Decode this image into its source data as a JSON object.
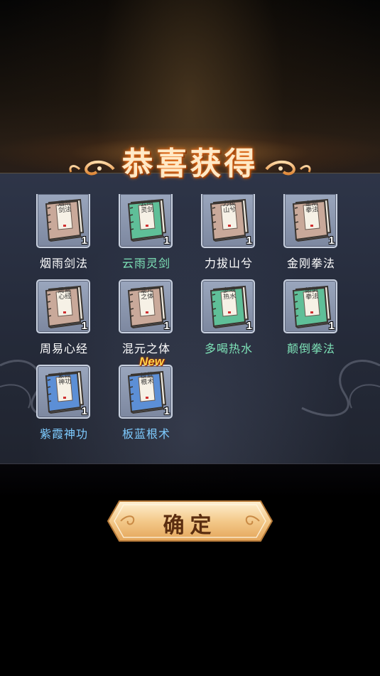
{
  "dialog": {
    "title": "恭喜获得",
    "confirm_label": "确定"
  },
  "rewards": [
    {
      "name": "烟雨剑法",
      "cover_text": "烟雨剑法",
      "quantity": "1",
      "cover_color": "#c9a99a",
      "name_color": "#ffffff",
      "is_new": false,
      "new_label": ""
    },
    {
      "name": "云雨灵剑",
      "cover_text": "云雨灵剑",
      "quantity": "1",
      "cover_color": "#5fbf98",
      "name_color": "#7ee3b8",
      "is_new": false,
      "new_label": ""
    },
    {
      "name": "力拔山兮",
      "cover_text": "力拔山兮",
      "quantity": "1",
      "cover_color": "#c9a99a",
      "name_color": "#ffffff",
      "is_new": false,
      "new_label": ""
    },
    {
      "name": "金刚拳法",
      "cover_text": "金刚拳法",
      "quantity": "1",
      "cover_color": "#c9a99a",
      "name_color": "#ffffff",
      "is_new": false,
      "new_label": ""
    },
    {
      "name": "周易心经",
      "cover_text": "周易心经",
      "quantity": "1",
      "cover_color": "#c9a99a",
      "name_color": "#ffffff",
      "is_new": false,
      "new_label": ""
    },
    {
      "name": "混元之体",
      "cover_text": "混元之体",
      "quantity": "1",
      "cover_color": "#c9a99a",
      "name_color": "#ffffff",
      "is_new": false,
      "new_label": ""
    },
    {
      "name": "多喝热水",
      "cover_text": "多喝热水",
      "quantity": "1",
      "cover_color": "#5fbf98",
      "name_color": "#7ee3b8",
      "is_new": false,
      "new_label": ""
    },
    {
      "name": "颠倒拳法",
      "cover_text": "颠倒拳法",
      "quantity": "1",
      "cover_color": "#5fbf98",
      "name_color": "#7ee3b8",
      "is_new": false,
      "new_label": ""
    },
    {
      "name": "紫霞神功",
      "cover_text": "紫霞神功",
      "quantity": "1",
      "cover_color": "#5c8fd6",
      "name_color": "#7ecbff",
      "is_new": false,
      "new_label": ""
    },
    {
      "name": "板蓝根术",
      "cover_text": "板蓝根术",
      "quantity": "1",
      "cover_color": "#5c8fd6",
      "name_color": "#7ecbff",
      "is_new": true,
      "new_label": "New"
    }
  ],
  "colors": {
    "title_glow": "#ff7a1a",
    "button_fill": "#f3c98a",
    "button_text": "#5a2d10"
  }
}
